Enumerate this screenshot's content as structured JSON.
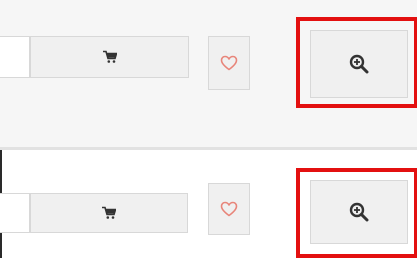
{
  "products": [
    {
      "quantity_value": "",
      "cart_button": {
        "icon": "cart-icon"
      },
      "wishlist_button": {
        "icon": "heart-icon"
      },
      "zoom_button": {
        "icon": "zoom-in-icon",
        "highlighted": true
      }
    },
    {
      "quantity_value": "",
      "cart_button": {
        "icon": "cart-icon"
      },
      "wishlist_button": {
        "icon": "heart-icon"
      },
      "zoom_button": {
        "icon": "zoom-in-icon",
        "highlighted": true
      }
    }
  ],
  "colors": {
    "highlight": "#e31010",
    "heart": "#e8857a",
    "icon": "#333333",
    "button_bg": "#f0f0f0",
    "button_border": "#d8d8d8",
    "row_bg": "#f6f6f6"
  }
}
